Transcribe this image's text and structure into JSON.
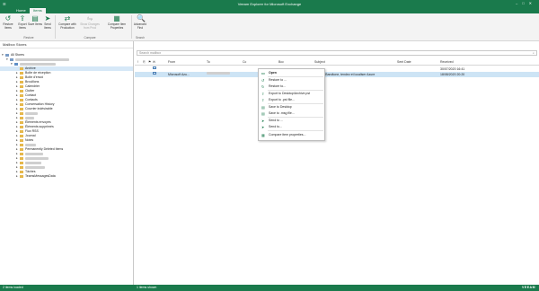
{
  "app": {
    "title": "Veeam Explorer for Microsoft Exchange",
    "window_controls": [
      "minimize",
      "maximize",
      "close"
    ]
  },
  "tabs": [
    {
      "label": "Home",
      "active": false
    },
    {
      "label": "Items",
      "active": true
    }
  ],
  "ribbon": {
    "buttons": [
      {
        "label": "Restore Items",
        "icon": "restore-icon",
        "enabled": true
      },
      {
        "label": "Export Items",
        "icon": "export-icon",
        "enabled": true
      },
      {
        "label": "Save Items",
        "icon": "save-icon",
        "enabled": true
      },
      {
        "label": "Send Items",
        "icon": "send-icon",
        "enabled": true
      },
      {
        "label": "Compare with Production",
        "icon": "compare-icon",
        "enabled": true
      },
      {
        "label": "Show Changes from Prod",
        "icon": "changes-icon",
        "enabled": false
      },
      {
        "label": "Compare Item Properties",
        "icon": "properties-icon",
        "enabled": true
      },
      {
        "label": "Advanced Find",
        "icon": "find-icon",
        "enabled": true
      }
    ],
    "groups": [
      "Restore",
      "Compare",
      "Search"
    ]
  },
  "left_pane": {
    "header": "Mailbox Stores",
    "tree": [
      {
        "label": "All Stores",
        "level": 0,
        "expanded": true
      },
      {
        "label": "",
        "level": 1,
        "redacted": true,
        "expanded": true
      },
      {
        "label": "",
        "level": 2,
        "redacted": true,
        "selected": true
      },
      {
        "label": "Archive",
        "level": 3
      },
      {
        "label": "Boîte de réception",
        "level": 3
      },
      {
        "label": "Boîte d'envoi",
        "level": 3
      },
      {
        "label": "Brouillons",
        "level": 3
      },
      {
        "label": "Calendrier",
        "level": 3
      },
      {
        "label": "Clutter",
        "level": 3
      },
      {
        "label": "Contact",
        "level": 3
      },
      {
        "label": "Contacts",
        "level": 3
      },
      {
        "label": "Conversation History",
        "level": 3
      },
      {
        "label": "Courrier indésirable",
        "level": 3
      },
      {
        "label": "",
        "level": 3,
        "redacted": true
      },
      {
        "label": "",
        "level": 3,
        "redacted": true
      },
      {
        "label": "Éléments envoyés",
        "level": 3
      },
      {
        "label": "Éléments supprimés",
        "level": 3
      },
      {
        "label": "Flux RSS",
        "level": 3
      },
      {
        "label": "Journal",
        "level": 3
      },
      {
        "label": "Notes",
        "level": 3
      },
      {
        "label": "",
        "level": 3,
        "redacted": true
      },
      {
        "label": "Permanently Deleted Items",
        "level": 3
      },
      {
        "label": "",
        "level": 3,
        "redacted": true
      },
      {
        "label": "",
        "level": 3,
        "redacted": true
      },
      {
        "label": "",
        "level": 3,
        "redacted": true
      },
      {
        "label": "",
        "level": 3,
        "redacted": true
      },
      {
        "label": "Tâches",
        "level": 3
      },
      {
        "label": "TeamsMessagesData",
        "level": 3
      }
    ]
  },
  "right_pane": {
    "search_placeholder": "Search mailbox",
    "columns": [
      "From",
      "To",
      "Cc",
      "Bcc",
      "Subject",
      "Sent Date",
      "Received"
    ],
    "rows": [
      {
        "from": "",
        "to": "",
        "cc": "",
        "bcc": "",
        "subject": "",
        "sent": "",
        "received": "30/07/2020 16:41",
        "selected": false
      },
      {
        "from": "Microsoft Azu...",
        "to": "",
        "cc": "",
        "bcc": "",
        "subject": "Utilisez Bandtone, tendez et localiser Azure",
        "sent": "",
        "received": "18/08/2020 20:20",
        "selected": true
      }
    ]
  },
  "context_menu": {
    "items": [
      {
        "label": "Open",
        "icon": "open-icon",
        "bold": true
      },
      {
        "label": "Restore to ...",
        "icon": "restore-icon",
        "bold": false
      },
      {
        "label": "Restore to...",
        "icon": "restore-to-icon",
        "bold": false
      },
      {
        "label": "Export to Desktop\\Archive.pst",
        "icon": "export-icon",
        "bold": false
      },
      {
        "label": "Export to .pst file...",
        "icon": "export-pst-icon",
        "bold": false
      },
      {
        "label": "Save to Desktop",
        "icon": "save-icon",
        "bold": false
      },
      {
        "label": "Save to .msg file...",
        "icon": "save-msg-icon",
        "bold": false
      },
      {
        "label": "Send to ...",
        "icon": "send-icon",
        "bold": false
      },
      {
        "label": "Send to...",
        "icon": "send-to-icon",
        "bold": false
      },
      {
        "label": "Compare item properties...",
        "icon": "compare-icon",
        "bold": false
      }
    ]
  },
  "status_bar": {
    "left": "2 items loaded",
    "middle": "1 items shown",
    "right": "VEEAM"
  },
  "colors": {
    "brand": "#1a7a4c",
    "selection": "#cde4f5"
  }
}
